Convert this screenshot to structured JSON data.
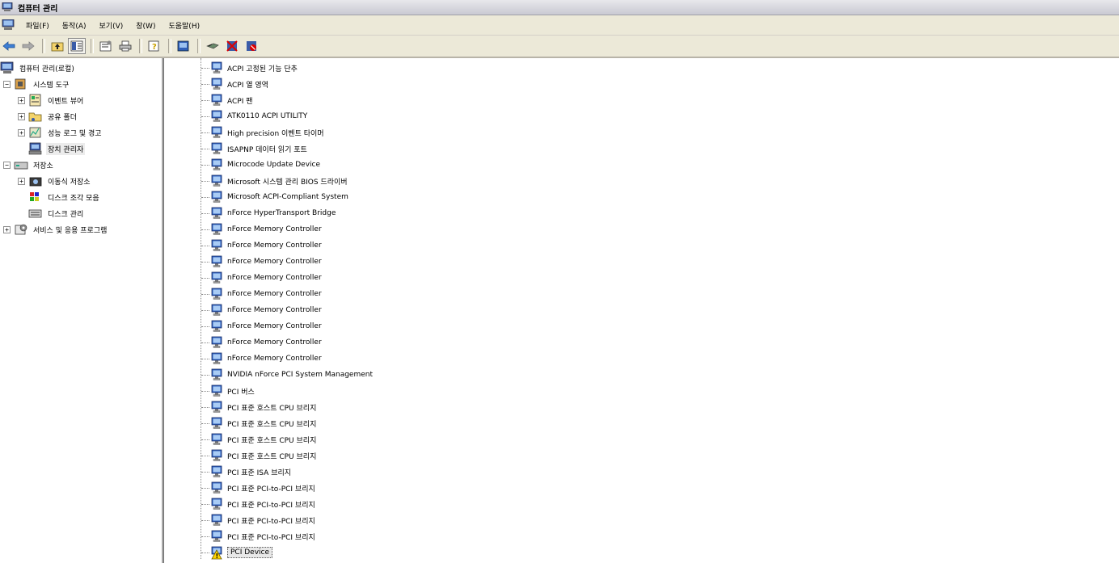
{
  "window": {
    "title": "컴퓨터 관리"
  },
  "menu": [
    "파일(F)",
    "동작(A)",
    "보기(V)",
    "창(W)",
    "도움말(H)"
  ],
  "toolbar": {
    "icons": [
      "back-icon",
      "forward-icon",
      "up-icon",
      "show-tree-icon",
      "properties-icon",
      "print-icon",
      "help-icon",
      "scan-icon",
      "update-driver-icon",
      "uninstall-icon",
      "disable-icon"
    ]
  },
  "tree": {
    "root": "컴퓨터 관리(로컬)",
    "system_tools": "시스템 도구",
    "event_viewer": "이벤트 뷰어",
    "shared_folders": "공유 폴더",
    "perf_logs": "성능 로그 및 경고",
    "device_manager": "장치 관리자",
    "storage": "저장소",
    "removable": "이동식 저장소",
    "defrag": "디스크 조각 모음",
    "disk_mgmt": "디스크 관리",
    "services": "서비스 및 응용 프로그램"
  },
  "devices": [
    "ACPI 고정된 기능 단추",
    "ACPI 열 영역",
    "ACPI 팬",
    "ATK0110 ACPI UTILITY",
    "High precision 이벤트 타이머",
    "ISAPNP 데이터 읽기 포트",
    "Microcode Update Device",
    "Microsoft 시스템 관리 BIOS 드라이버",
    "Microsoft ACPI-Compliant System",
    "nForce HyperTransport Bridge",
    "nForce Memory Controller",
    "nForce Memory Controller",
    "nForce Memory Controller",
    "nForce Memory Controller",
    "nForce Memory Controller",
    "nForce Memory Controller",
    "nForce Memory Controller",
    "nForce Memory Controller",
    "nForce Memory Controller",
    "NVIDIA nForce PCI System Management",
    "PCI 버스",
    "PCI 표준 호스트 CPU 브리지",
    "PCI 표준 호스트 CPU 브리지",
    "PCI 표준 호스트 CPU 브리지",
    "PCI 표준 호스트 CPU 브리지",
    "PCI 표준 ISA 브리지",
    "PCI 표준 PCI-to-PCI 브리지",
    "PCI 표준 PCI-to-PCI 브리지",
    "PCI 표준 PCI-to-PCI 브리지",
    "PCI 표준 PCI-to-PCI 브리지",
    "PCI Device"
  ],
  "warning_device": "PCI Device"
}
